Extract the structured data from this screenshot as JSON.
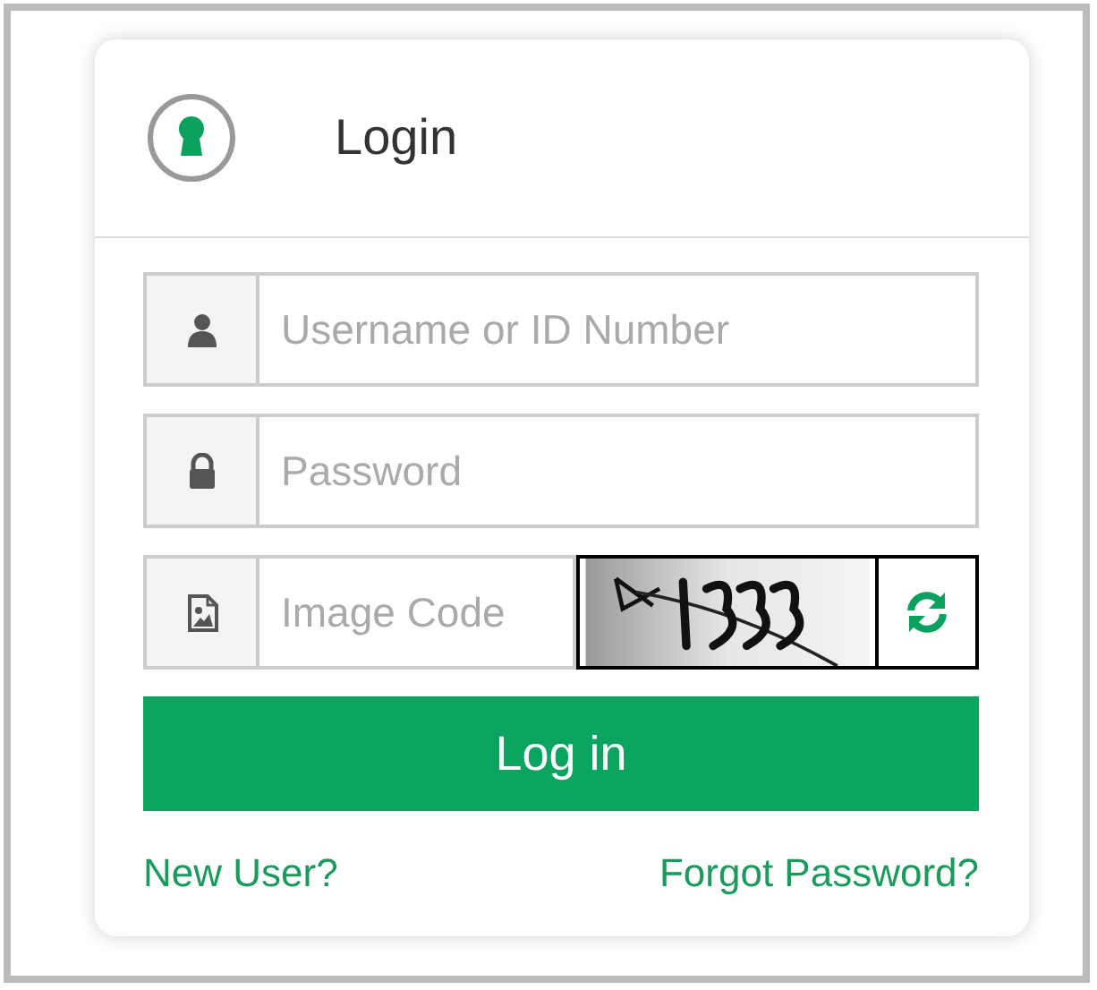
{
  "header": {
    "title": "Login"
  },
  "fields": [
    {
      "kind": "user",
      "placeholder": "Username or ID Number"
    },
    {
      "kind": "password",
      "placeholder": "Password"
    },
    {
      "kind": "captcha",
      "placeholder": "Image Code"
    }
  ],
  "button": {
    "label": "Log in"
  },
  "links": [
    {
      "label": "New User?"
    },
    {
      "label": "Forgot Password?"
    }
  ]
}
